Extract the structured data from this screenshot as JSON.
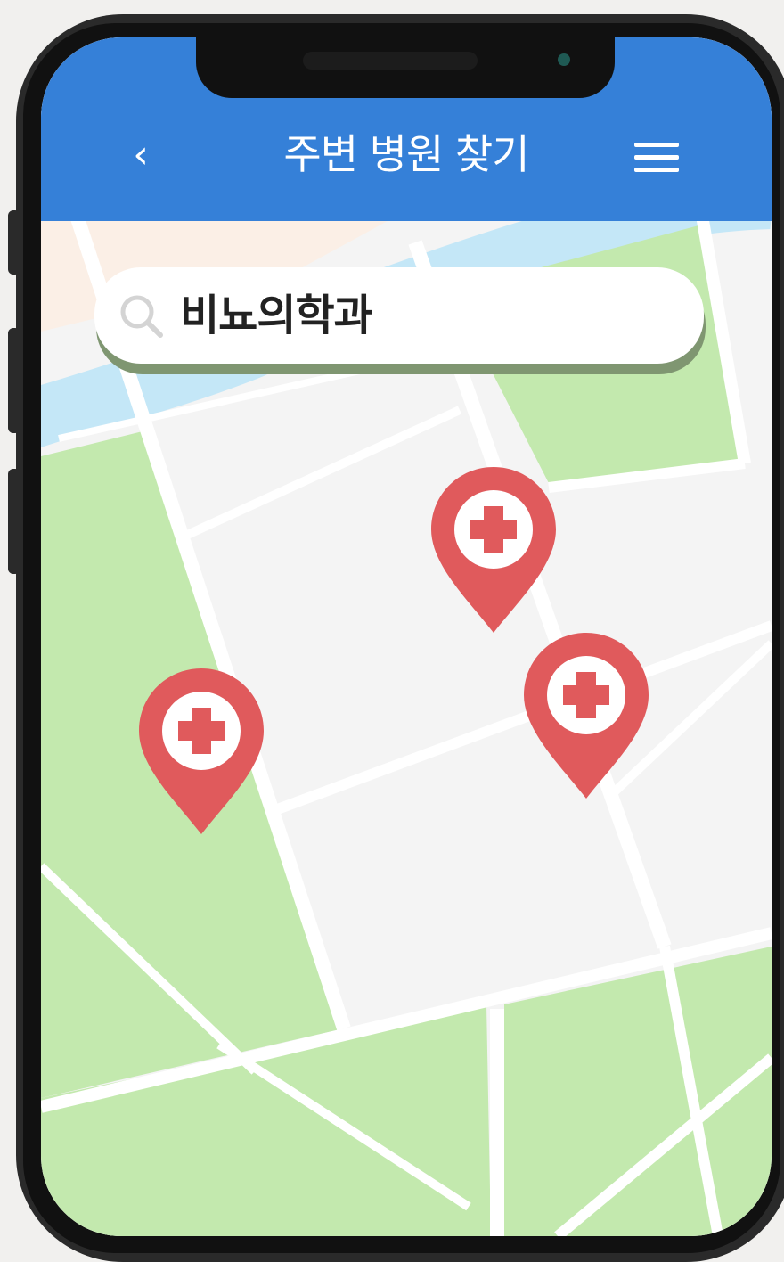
{
  "header": {
    "back_icon": "chevron-left-icon",
    "title": "주변 병원 찾기",
    "menu_icon": "hamburger-menu-icon",
    "background_color": "#3580d8"
  },
  "search": {
    "icon": "search-icon",
    "value": "비뇨의학과"
  },
  "map": {
    "colors": {
      "land": "#f4f4f4",
      "park": "#c3e9ae",
      "water": "#c4e7f7",
      "sand": "#fbefe6",
      "road": "#ffffff"
    },
    "markers": [
      {
        "name": "hospital-marker-1",
        "icon": "medical-cross-icon"
      },
      {
        "name": "hospital-marker-2",
        "icon": "medical-cross-icon"
      },
      {
        "name": "hospital-marker-3",
        "icon": "medical-cross-icon"
      }
    ],
    "marker_color": "#e05a5c"
  }
}
